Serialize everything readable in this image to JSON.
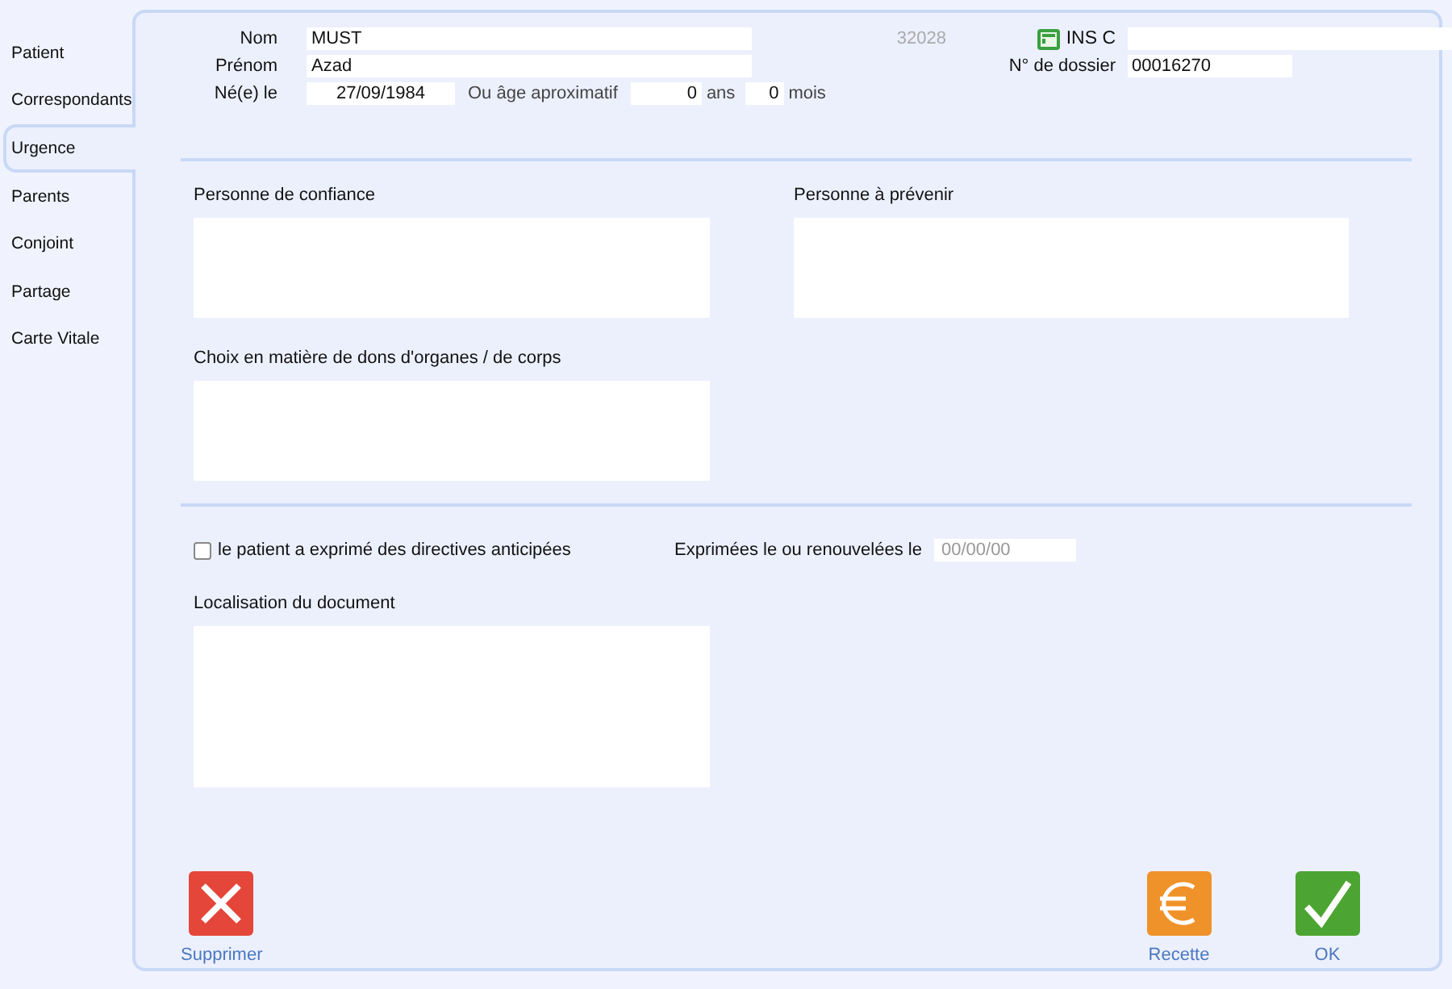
{
  "tabs": [
    {
      "label": "Patient",
      "selected": false
    },
    {
      "label": "Correspondants",
      "selected": false
    },
    {
      "label": "Urgence",
      "selected": true
    },
    {
      "label": "Parents",
      "selected": false
    },
    {
      "label": "Conjoint",
      "selected": false
    },
    {
      "label": "Partage",
      "selected": false
    },
    {
      "label": "Carte Vitale",
      "selected": false
    }
  ],
  "identity": {
    "nom_label": "Nom",
    "nom": "MUST",
    "prenom_label": "Prénom",
    "prenom": "Azad",
    "birth_label": "Né(e) le",
    "birth": "27/09/1984",
    "age_label": "Ou âge aproximatif",
    "years": "0",
    "years_unit": "ans",
    "months": "0",
    "months_unit": "mois",
    "patient_number": "32028",
    "ins_label": "INS C",
    "dossier_label": "N° de dossier",
    "dossier": "00016270"
  },
  "sections": [
    {
      "label": "Personne de confiance"
    },
    {
      "label": "Personne à prévenir"
    },
    {
      "label": "Choix en matière de dons d'organes / de corps"
    }
  ],
  "directives": {
    "label": "le patient a exprimé des directives anticipées",
    "checked": false,
    "date_label": "Exprimées le ou renouvelées le",
    "date_placeholder": "00/00/00",
    "location_label": "Localisation du document"
  },
  "buttons": [
    {
      "kind": "delete",
      "label": "Supprimer"
    },
    {
      "kind": "payment",
      "label": "Recette"
    },
    {
      "kind": "ok",
      "label": "OK"
    }
  ]
}
